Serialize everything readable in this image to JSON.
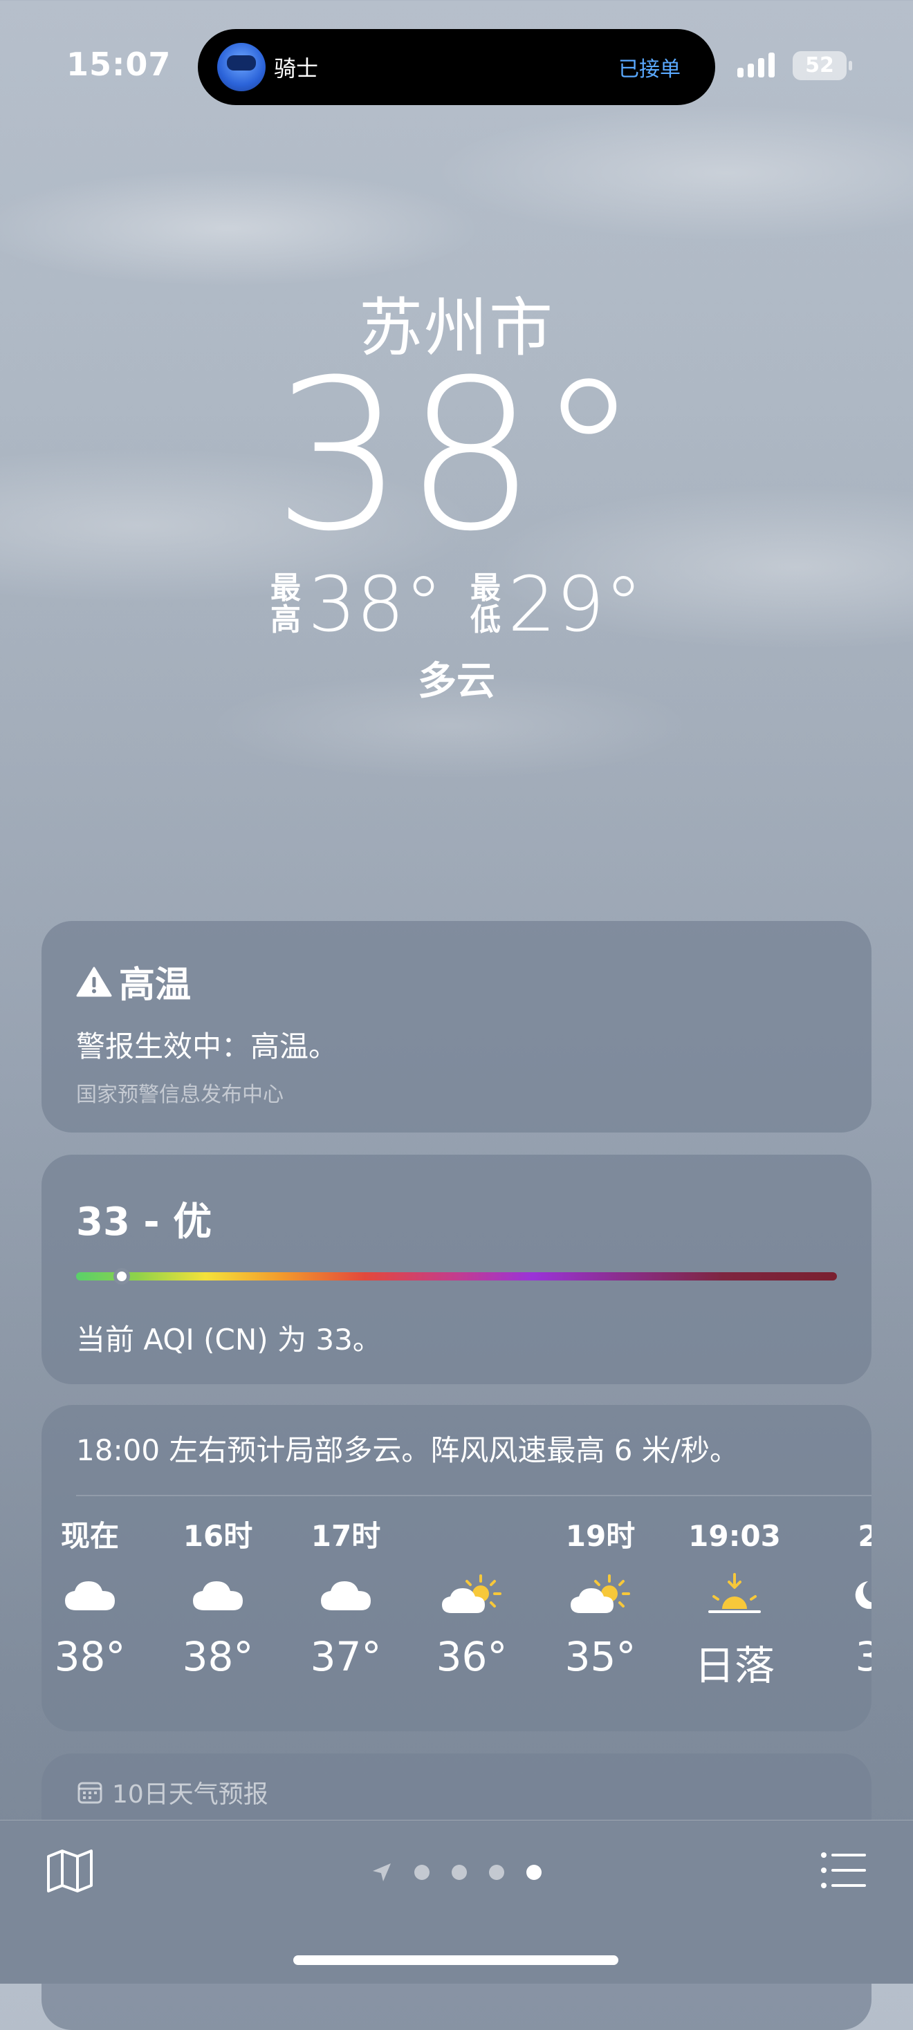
{
  "status_bar": {
    "time": "15:07",
    "live_activity": {
      "app_label": "骑士",
      "status": "已接单"
    },
    "battery": "52"
  },
  "header": {
    "city": "苏州市",
    "temperature": "38°",
    "high_label": "最高",
    "high": "38°",
    "low_label": "最低",
    "low": "29°",
    "condition": "多云"
  },
  "alert": {
    "title": "高温",
    "message": "警报生效中：高温。",
    "source": "国家预警信息发布中心"
  },
  "aqi": {
    "title": "33 - 优",
    "message": "当前 AQI (CN) 为 33。",
    "level_fraction": 0.06
  },
  "hourly": {
    "summary": "18:00 左右预计局部多云。阵风风速最高 6 米/秒。",
    "items": [
      {
        "label": "现在",
        "icon": "cloud-icon",
        "temp": "38°"
      },
      {
        "label": "16时",
        "icon": "cloud-icon",
        "temp": "38°"
      },
      {
        "label": "17时",
        "icon": "cloud-icon",
        "temp": "37°"
      },
      {
        "label": "",
        "icon": "partly-sunny-icon",
        "temp": "36°"
      },
      {
        "label": "19时",
        "icon": "partly-sunny-icon",
        "temp": "35°"
      },
      {
        "label": "19:03",
        "icon": "sunset-icon",
        "temp": "日落"
      },
      {
        "label": "2",
        "icon": "moon-icon",
        "temp": "3"
      }
    ]
  },
  "forecast": {
    "title": "10日天气预报"
  },
  "tab_bar": {
    "page_count": 4,
    "active_page": 4
  },
  "colors": {
    "live_activity_status": "#5aa9ff",
    "card_bg": "#76829"
  }
}
